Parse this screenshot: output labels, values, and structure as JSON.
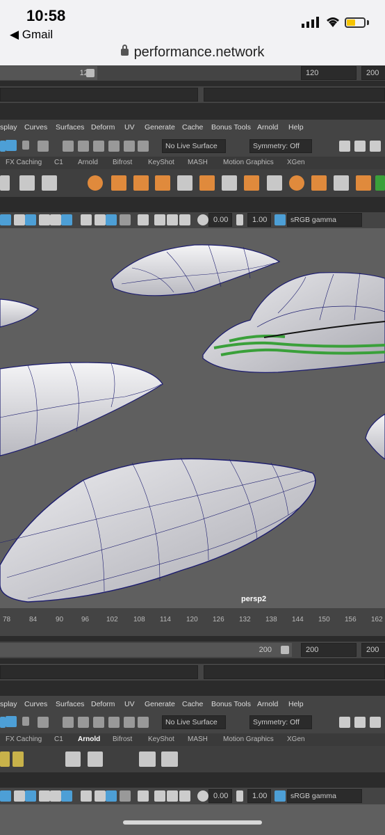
{
  "status": {
    "time": "10:58",
    "back_label": "◀ Gmail",
    "url": "performance.network"
  },
  "range_top": {
    "field_a": "120",
    "field_b": "120",
    "field_c": "200"
  },
  "menu": [
    "splay",
    "Curves",
    "Surfaces",
    "Deform",
    "UV",
    "Generate",
    "Cache",
    "Bonus Tools",
    "Arnold",
    "Help"
  ],
  "toolbar": {
    "live_surface": "No Live Surface",
    "symmetry": "Symmetry: Off"
  },
  "shelf_tabs": [
    "FX Caching",
    "C1",
    "Arnold",
    "Bifrost",
    "KeyShot",
    "MASH",
    "Motion Graphics",
    "XGen"
  ],
  "viewport_bar": {
    "exposure": "0.00",
    "gamma": "1.00",
    "color_space": "sRGB gamma"
  },
  "camera_label": "persp2",
  "timeline_ticks": [
    "78",
    "84",
    "90",
    "96",
    "102",
    "108",
    "114",
    "120",
    "126",
    "132",
    "138",
    "144",
    "150",
    "156",
    "162"
  ],
  "range_bottom": {
    "field_a": "200",
    "field_b": "200",
    "field_c": "200"
  },
  "menu2": [
    "splay",
    "Curves",
    "Surfaces",
    "Deform",
    "UV",
    "Generate",
    "Cache",
    "Bonus Tools",
    "Arnold",
    "Help"
  ],
  "toolbar2": {
    "live_surface": "No Live Surface",
    "symmetry": "Symmetry: Off"
  },
  "shelf_tabs2": [
    "FX Caching",
    "C1",
    "Arnold",
    "Bifrost",
    "KeyShot",
    "MASH",
    "Motion Graphics",
    "XGen"
  ],
  "shelf_tabs2_active": "Arnold",
  "viewport_bar2": {
    "exposure": "0.00",
    "gamma": "1.00",
    "color_space": "sRGB gamma"
  },
  "colors": {
    "accent_blue": "#4d9fd6",
    "shelf_orange": "#e08a3c",
    "highlight_green": "#3aa03a",
    "surface_edge": "#1c1c6e"
  }
}
